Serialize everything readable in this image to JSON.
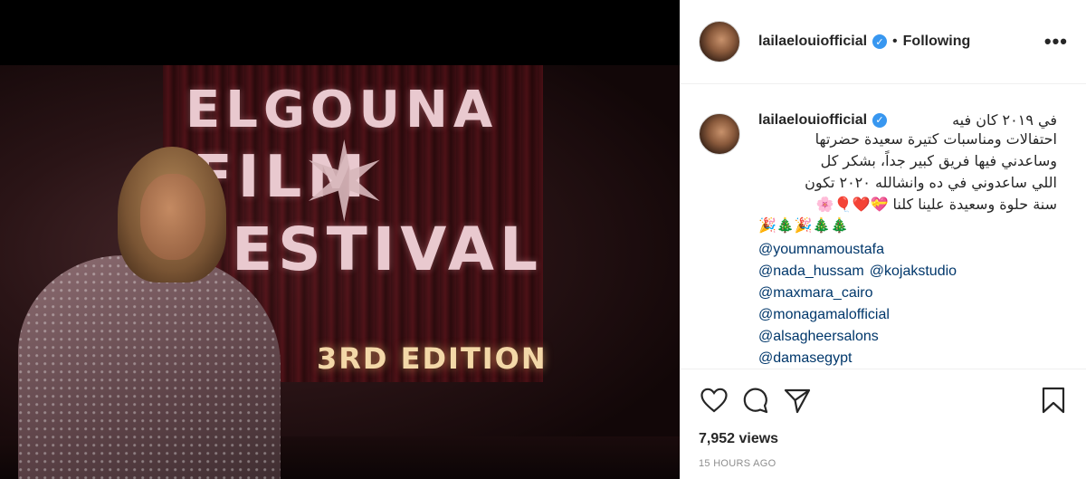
{
  "media": {
    "sign_line1": "ELGOUNA",
    "sign_line2": "FILM",
    "sign_line3": "FESTIVAL",
    "sign_edition": "3RD EDITION"
  },
  "header": {
    "username": "lailaelouiofficial",
    "separator": "•",
    "follow_status": "Following",
    "more_label": "•••"
  },
  "caption": {
    "username": "lailaelouiofficial",
    "first_line": "في ٢٠١٩ كان فيه",
    "lines": [
      "احتفالات ومناسبات كتيرة سعيدة حضرتها",
      "وساعدني فيها فريق كبير جداً، بشكر كل",
      "اللي ساعدوني في ده وانشالله ٢٠٢٠ تكون",
      "سنة حلوة وسعيدة علينا كلنا 💝❤️🎈🌸"
    ],
    "emoji_line": "🎉🎄🎉🎄🎄",
    "tags": [
      [
        "@youmnamoustafa"
      ],
      [
        "@nada_hussam",
        "@kojakstudio"
      ],
      [
        "@maxmara_cairo"
      ],
      [
        "@monagamalofficial"
      ],
      [
        "@alsagheersalons"
      ],
      [
        "@damasegypt"
      ]
    ]
  },
  "stats": {
    "views": "7,952 views",
    "timestamp": "15 HOURS AGO"
  },
  "icons": {
    "like": "heart-icon",
    "comment": "comment-icon",
    "share": "share-icon",
    "save": "bookmark-icon",
    "verified": "verified-badge-icon"
  },
  "colors": {
    "link": "#00376b",
    "verified": "#3897f0",
    "text": "#262626",
    "muted": "#8e8e8e"
  }
}
